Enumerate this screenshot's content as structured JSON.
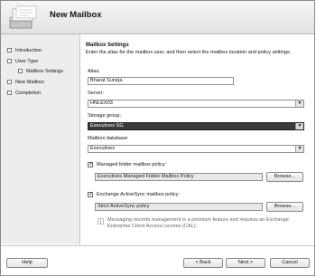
{
  "wizard": {
    "title": "New Mailbox"
  },
  "sidebar": {
    "steps": [
      {
        "label": "Introduction"
      },
      {
        "label": "User Type"
      },
      {
        "label": "Mailbox Settings"
      },
      {
        "label": "New Mailbox"
      },
      {
        "label": "Completion"
      }
    ]
  },
  "main": {
    "section_title": "Mailbox Settings",
    "description": "Enter the alias for the mailbox user, and then select the mailbox location and policy settings.",
    "alias": {
      "label": "Alias:",
      "value": "Bharat Suneja"
    },
    "server": {
      "label": "Server:",
      "value": "HNLEX03"
    },
    "storage_group": {
      "label": "Storage group:",
      "value": "Executives SG"
    },
    "mailbox_database": {
      "label": "Mailbox database:",
      "value": "Executives"
    },
    "managed_folder": {
      "label": "Managed folder mailbox policy:",
      "checked": true,
      "value": "Executives Managed Folder Mailbox Policy",
      "browse": "Browse..."
    },
    "activesync": {
      "label": "Exchange ActiveSync mailbox policy:",
      "checked": true,
      "value": "Strict ActiveSync policy",
      "browse": "Browse..."
    },
    "notice": "Messaging records management is a premium feature and requires an Exchange Enterprise Client Access License (CAL)."
  },
  "footer": {
    "help": "Help",
    "back": "< Back",
    "next": "Next >",
    "cancel": "Cancel"
  }
}
